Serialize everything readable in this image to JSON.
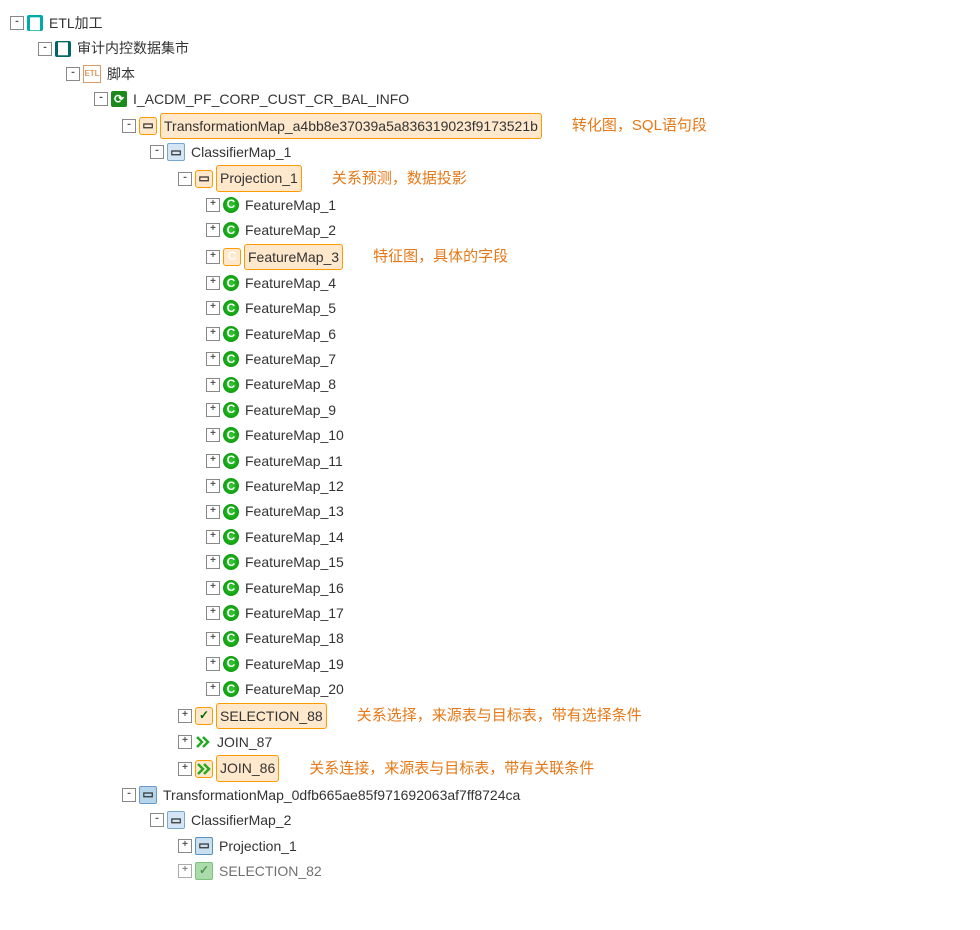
{
  "root": {
    "label": "ETL加工"
  },
  "l1": {
    "label": "审计内控数据集市"
  },
  "l2": {
    "label": "脚本"
  },
  "l3": {
    "label": "I_ACDM_PF_CORP_CUST_CR_BAL_INFO"
  },
  "tmap1": {
    "label": "TransformationMap_a4bb8e37039a5a836319023f9173521b",
    "annot": "转化图，SQL语句段"
  },
  "cls1": {
    "label": "ClassifierMap_1"
  },
  "proj1": {
    "label": "Projection_1",
    "annot": "关系预测，数据投影"
  },
  "fm": [
    "FeatureMap_1",
    "FeatureMap_2",
    "FeatureMap_3",
    "FeatureMap_4",
    "FeatureMap_5",
    "FeatureMap_6",
    "FeatureMap_7",
    "FeatureMap_8",
    "FeatureMap_9",
    "FeatureMap_10",
    "FeatureMap_11",
    "FeatureMap_12",
    "FeatureMap_13",
    "FeatureMap_14",
    "FeatureMap_15",
    "FeatureMap_16",
    "FeatureMap_17",
    "FeatureMap_18",
    "FeatureMap_19",
    "FeatureMap_20"
  ],
  "fm3_annot": "特征图，具体的字段",
  "sel88": {
    "label": "SELECTION_88",
    "annot": "关系选择，来源表与目标表，带有选择条件"
  },
  "join87": {
    "label": "JOIN_87"
  },
  "join86": {
    "label": "JOIN_86",
    "annot": "关系连接，来源表与目标表，带有关联条件"
  },
  "tmap2": {
    "label": "TransformationMap_0dfb665ae85f971692063af7ff8724ca"
  },
  "cls2": {
    "label": "ClassifierMap_2"
  },
  "proj2": {
    "label": "Projection_1"
  },
  "sel82": {
    "label": "SELECTION_82"
  }
}
